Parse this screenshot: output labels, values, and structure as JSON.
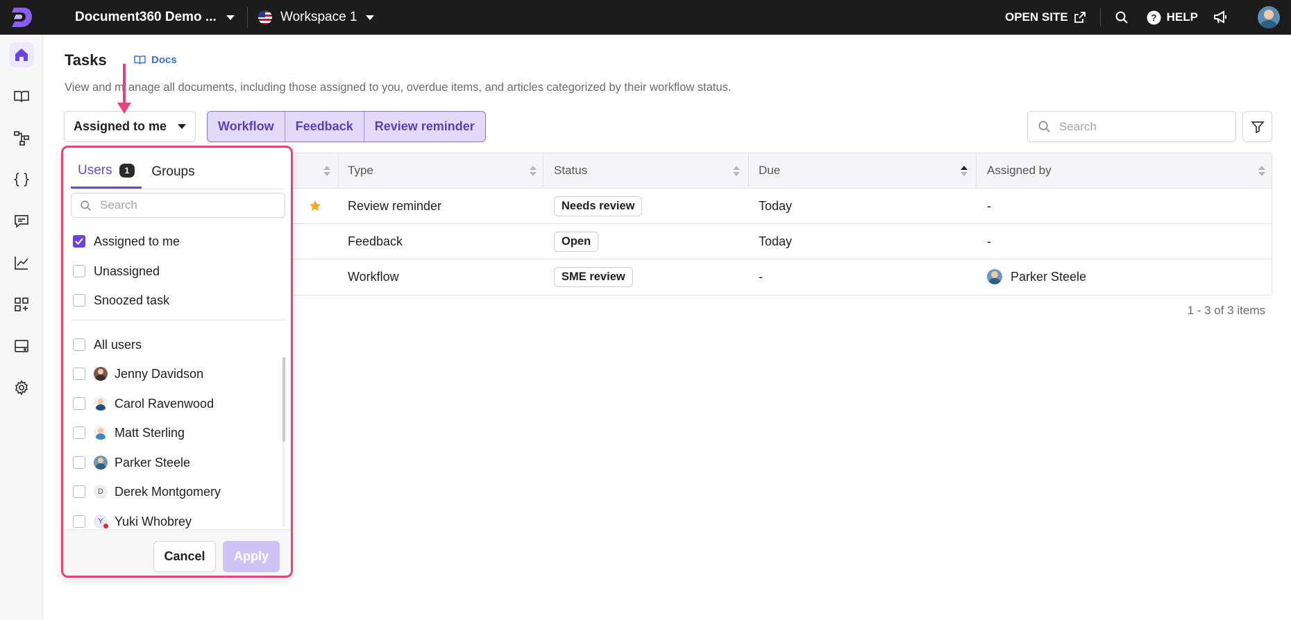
{
  "topbar": {
    "project_name": "Document360 Demo ...",
    "workspace_name": "Workspace 1",
    "open_site_label": "OPEN SITE",
    "help_label": "HELP"
  },
  "sidebar": {
    "items": [
      {
        "name": "home-icon",
        "active": true
      },
      {
        "name": "book-icon",
        "active": false
      },
      {
        "name": "hierarchy-icon",
        "active": false
      },
      {
        "name": "braces-icon",
        "active": false
      },
      {
        "name": "comment-icon",
        "active": false
      },
      {
        "name": "analytics-icon",
        "active": false
      },
      {
        "name": "apps-icon",
        "active": false
      },
      {
        "name": "drive-icon",
        "active": false
      },
      {
        "name": "gear-icon",
        "active": false
      }
    ]
  },
  "header": {
    "title": "Tasks",
    "docs_label": "Docs",
    "subtitle_start": "View and m",
    "subtitle_end": "anage all documents, including those assigned to you, overdue items, and articles categorized by their workflow status."
  },
  "toolbar": {
    "assigned_label": "Assigned to me",
    "segments": [
      "Workflow",
      "Feedback",
      "Review reminder"
    ],
    "search_placeholder": "Search"
  },
  "table": {
    "columns": [
      "Type",
      "Status",
      "Due",
      "Assigned by"
    ],
    "rows": [
      {
        "type": "Review reminder",
        "status": "Needs review",
        "due": "Today",
        "assigned_by": "-",
        "starred": true
      },
      {
        "type": "Feedback",
        "status": "Open",
        "due": "Today",
        "assigned_by": "-",
        "starred": false
      },
      {
        "type": "Workflow",
        "status": "SME review",
        "due": "-",
        "assigned_by": "Parker Steele",
        "starred": false
      }
    ],
    "pagination": "1 - 3 of 3 items"
  },
  "dropdown": {
    "tabs": [
      {
        "label": "Users",
        "count": "1"
      },
      {
        "label": "Groups"
      }
    ],
    "search_placeholder": "Search",
    "options": [
      {
        "label": "Assigned to me",
        "checked": true
      },
      {
        "label": "Unassigned",
        "checked": false
      },
      {
        "label": "Snoozed task",
        "checked": false
      }
    ],
    "all_users_label": "All users",
    "users": [
      {
        "name": "Jenny Davidson"
      },
      {
        "name": "Carol Ravenwood"
      },
      {
        "name": "Matt Sterling"
      },
      {
        "name": "Parker Steele"
      },
      {
        "name": "Derek Montgomery",
        "initial": "D"
      },
      {
        "name": "Yuki Whobrey",
        "initial": "Y"
      }
    ],
    "cancel_label": "Cancel",
    "apply_label": "Apply"
  },
  "colors": {
    "accent": "#6a45d8",
    "highlight_annotation": "#e0457b",
    "topbar_bg": "#1c1c1c"
  }
}
